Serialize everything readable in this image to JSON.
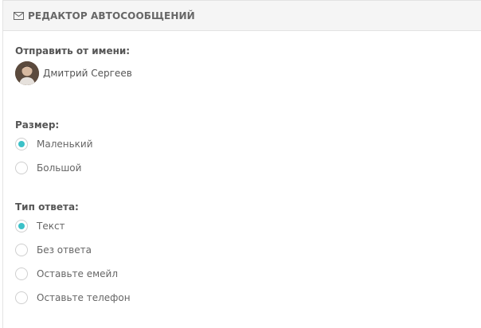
{
  "header": {
    "icon": "envelope-icon",
    "title": "РЕДАКТОР АВТОСООБЩЕНИЙ"
  },
  "sender": {
    "label": "Отправить от имени:",
    "name": "Дмитрий Сергеев"
  },
  "size": {
    "label": "Размер:",
    "options": [
      "Маленький",
      "Большой"
    ],
    "selected": 0
  },
  "reply_type": {
    "label": "Тип ответа:",
    "options": [
      "Текст",
      "Без ответа",
      "Оставьте емейл",
      "Оставьте телефон"
    ],
    "selected": 0
  },
  "colors": {
    "accent": "#3cc1c8",
    "header_bg": "#f5f5f5"
  }
}
